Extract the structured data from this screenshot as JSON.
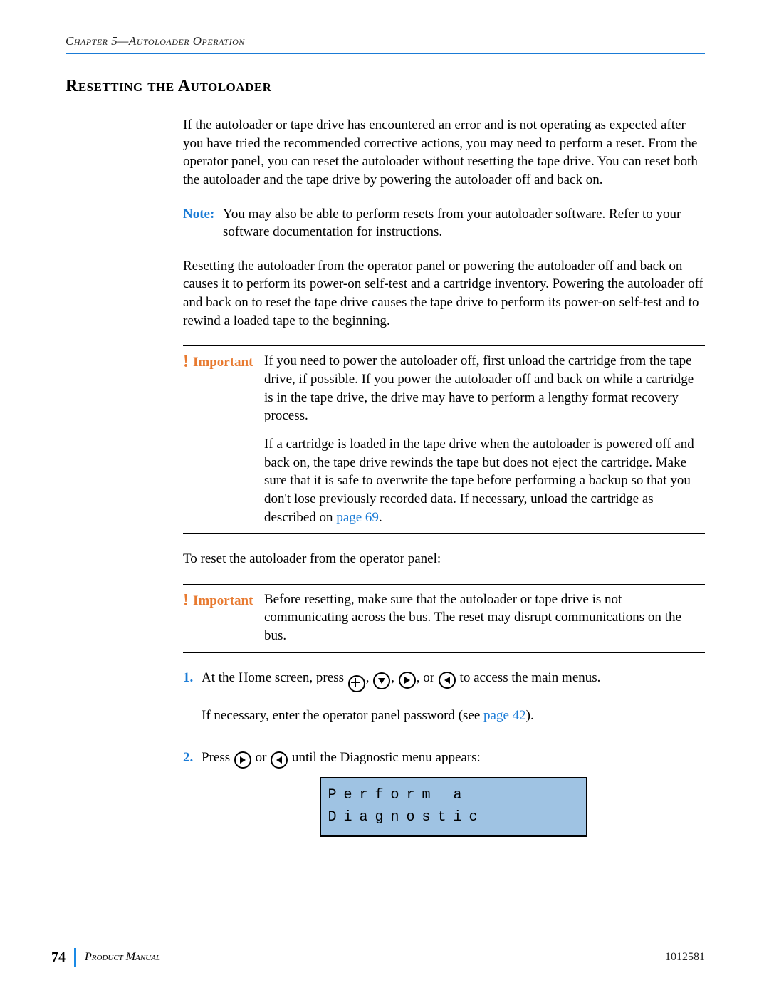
{
  "header": {
    "chapter_line": "Chapter 5—Autoloader Operation"
  },
  "section": {
    "title": "Resetting the Autoloader"
  },
  "body": {
    "intro_p1": "If the autoloader or tape drive has encountered an error and is not operating as expected after you have tried the recommended corrective actions, you may need to perform a reset. From the operator panel, you can reset the autoloader without resetting the tape drive. You can reset both the autoloader and the tape drive by powering the autoloader off and back on.",
    "note": {
      "label": "Note:",
      "text": "You may also be able to perform resets from your autoloader software. Refer to your software documentation for instructions."
    },
    "p2": "Resetting the autoloader from the operator panel or powering the autoloader off and back on causes it to perform its power-on self-test and a cartridge inventory. Powering the autoloader off and back on to reset the tape drive causes the tape drive to perform its power-on self-test and to rewind a loaded tape to the beginning.",
    "important1": {
      "label": "Important",
      "p1": "If you need to power the autoloader off, first unload the cartridge from the tape drive, if possible. If you power the autoloader off and back on while a cartridge is in the tape drive, the drive may have to perform a lengthy format recovery process.",
      "p2_a": "If a cartridge is loaded in the tape drive when the autoloader is powered off and back on, the tape drive rewinds the tape but does not eject the cartridge. Make sure that it is safe to overwrite the tape before performing a backup so that you don't lose previously recorded data. If necessary, unload the cartridge as described on ",
      "p2_link": "page 69",
      "p2_b": "."
    },
    "p3": "To reset the autoloader from the operator panel:",
    "important2": {
      "label": "Important",
      "text": "Before resetting, make sure that the autoloader or tape drive is not communicating across the bus. The reset may disrupt communications on the bus."
    },
    "steps": {
      "s1": {
        "num": "1.",
        "line1_a": "At the Home screen, press ",
        "line1_b": ", ",
        "line1_c": ", ",
        "line1_d": ", or ",
        "line1_e": " to access the main menus.",
        "line2_a": "If necessary, enter the operator panel password (see ",
        "line2_link": "page 42",
        "line2_b": ")."
      },
      "s2": {
        "num": "2.",
        "line_a": "Press ",
        "line_b": " or ",
        "line_c": " until the Diagnostic menu appears:"
      }
    },
    "lcd": {
      "line1": "Perform a",
      "line2": "Diagnostic"
    }
  },
  "footer": {
    "page_number": "74",
    "manual_title": "Product Manual",
    "pub_id": "1012581"
  }
}
